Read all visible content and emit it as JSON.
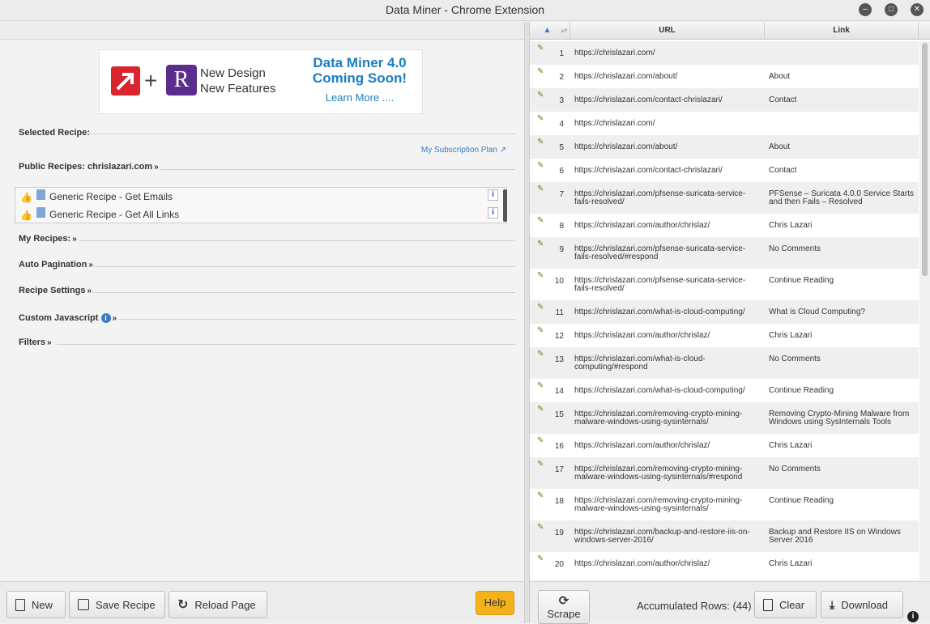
{
  "window": {
    "title": "Data Miner - Chrome Extension"
  },
  "banner": {
    "headline": "Data Miner 4.0 Coming Soon!",
    "line1": "New Design",
    "line2": "New Features",
    "cta": "Learn More ....",
    "logo_letter": "R"
  },
  "sections": {
    "selected_recipe": "Selected Recipe:",
    "subscription_link": "My Subscription Plan",
    "public_recipes": "Public Recipes:",
    "public_recipes_site": "chrislazari.com",
    "my_recipes": "My Recipes:",
    "auto_pagination": "Auto Pagination",
    "recipe_settings": "Recipe Settings",
    "custom_javascript": "Custom Javascript",
    "filters": "Filters"
  },
  "recipes": [
    "Generic Recipe - Get Emails",
    "Generic Recipe - Get All Links"
  ],
  "buttons": {
    "new": "New",
    "save_recipe": "Save Recipe",
    "reload_page": "Reload Page",
    "help": "Help",
    "scrape": "Scrape",
    "clear": "Clear",
    "download": "Download"
  },
  "table": {
    "headers": {
      "url": "URL",
      "link": "Link"
    },
    "rows": [
      {
        "n": "1",
        "url": "https://chrislazari.com/",
        "link": ""
      },
      {
        "n": "2",
        "url": "https://chrislazari.com/about/",
        "link": "About"
      },
      {
        "n": "3",
        "url": "https://chrislazari.com/contact-chrislazari/",
        "link": "Contact"
      },
      {
        "n": "4",
        "url": "https://chrislazari.com/",
        "link": ""
      },
      {
        "n": "5",
        "url": "https://chrislazari.com/about/",
        "link": "About"
      },
      {
        "n": "6",
        "url": "https://chrislazari.com/contact-chrislazari/",
        "link": "Contact"
      },
      {
        "n": "7",
        "url": "https://chrislazari.com/pfsense-suricata-service-fails-resolved/",
        "link": "PFSense – Suricata 4.0.0 Service Starts and then Fails – Resolved"
      },
      {
        "n": "8",
        "url": "https://chrislazari.com/author/chrislaz/",
        "link": "Chris Lazari"
      },
      {
        "n": "9",
        "url": "https://chrislazari.com/pfsense-suricata-service-fails-resolved/#respond",
        "link": "No Comments"
      },
      {
        "n": "10",
        "url": "https://chrislazari.com/pfsense-suricata-service-fails-resolved/",
        "link": "Continue Reading"
      },
      {
        "n": "11",
        "url": "https://chrislazari.com/what-is-cloud-computing/",
        "link": "What is Cloud Computing?"
      },
      {
        "n": "12",
        "url": "https://chrislazari.com/author/chrislaz/",
        "link": "Chris Lazari"
      },
      {
        "n": "13",
        "url": "https://chrislazari.com/what-is-cloud-computing/#respond",
        "link": "No Comments"
      },
      {
        "n": "14",
        "url": "https://chrislazari.com/what-is-cloud-computing/",
        "link": "Continue Reading"
      },
      {
        "n": "15",
        "url": "https://chrislazari.com/removing-crypto-mining-malware-windows-using-sysinternals/",
        "link": "Removing Crypto-Mining Malware from Windows using SysInternals Tools"
      },
      {
        "n": "16",
        "url": "https://chrislazari.com/author/chrislaz/",
        "link": "Chris Lazari"
      },
      {
        "n": "17",
        "url": "https://chrislazari.com/removing-crypto-mining-malware-windows-using-sysinternals/#respond",
        "link": "No Comments"
      },
      {
        "n": "18",
        "url": "https://chrislazari.com/removing-crypto-mining-malware-windows-using-sysinternals/",
        "link": "Continue Reading"
      },
      {
        "n": "19",
        "url": "https://chrislazari.com/backup-and-restore-iis-on-windows-server-2016/",
        "link": "Backup and Restore IIS on Windows Server 2016"
      },
      {
        "n": "20",
        "url": "https://chrislazari.com/author/chrislaz/",
        "link": "Chris Lazari"
      }
    ]
  },
  "status": {
    "accumulated_rows": "Accumulated Rows: (44)"
  },
  "colors": {
    "help": "#f3b21a",
    "link": "#3a7bbf",
    "banner_red": "#d9262e",
    "banner_purple": "#5b2d8e",
    "banner_blue": "#1a7fc1"
  }
}
